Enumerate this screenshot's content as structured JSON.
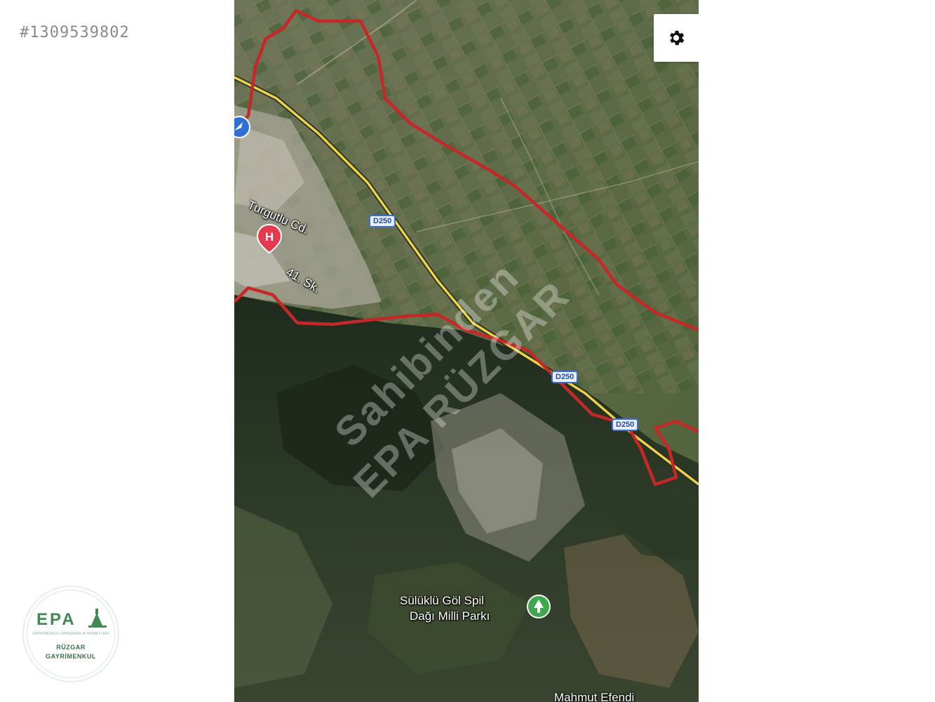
{
  "listing": {
    "id_text": "#1309539802"
  },
  "map": {
    "type": "satellite",
    "road_shields": [
      "D250",
      "D250",
      "D250"
    ],
    "labels": {
      "street_1": "Turgutlu Cd.",
      "street_2": "41. Sk.",
      "park_line1": "Sülüklü Göl Spil",
      "park_line2": "Dağı Milli Parkı",
      "bottom_place": "Mahmut Efendi"
    },
    "watermark": {
      "line1": "Sahibinden",
      "line2": "EPA RÜZGAR"
    },
    "icons": {
      "settings": "gear-icon",
      "hospital": "hospital-pin-icon",
      "park": "park-pin-icon",
      "navigation": "navigation-arrow-icon"
    },
    "colors": {
      "boundary": "#c62828",
      "road": "#e8d44a",
      "hospital": "#e53950",
      "park": "#3fa84f"
    }
  },
  "logo": {
    "brand": "EPA",
    "tagline": "GAYRİMENKUL DANIŞMANLIK HİZMETLERİ",
    "line1": "RÜZGAR",
    "line2": "GAYRİMENKUL"
  }
}
